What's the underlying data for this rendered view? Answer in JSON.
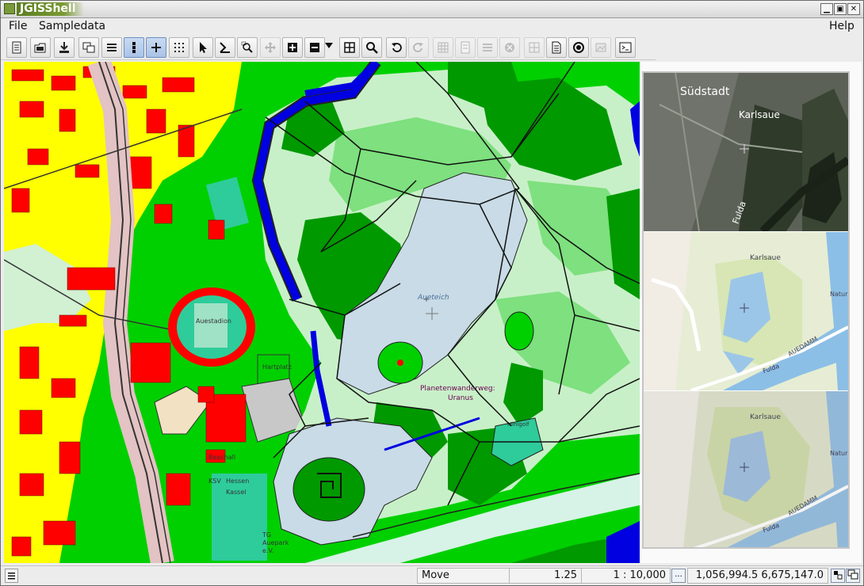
{
  "window": {
    "title": "JGISShell",
    "controls": {
      "minimize": "▁",
      "maximize": "▣",
      "close": "✕"
    }
  },
  "menu": {
    "file": "File",
    "sampledata": "Sampledata",
    "help": "Help"
  },
  "toolbar": {
    "tools": [
      {
        "name": "new-project",
        "icon": "document-icon",
        "state": "normal"
      },
      {
        "name": "open-project",
        "icon": "folder-open-icon",
        "state": "normal"
      },
      {
        "name": "save-project",
        "icon": "download-icon",
        "state": "normal"
      },
      {
        "name": "layers",
        "icon": "windows-icon",
        "state": "normal"
      },
      {
        "name": "list",
        "icon": "list-icon",
        "state": "normal"
      },
      {
        "name": "vertical-dots",
        "icon": "vertical-dots-icon",
        "state": "active"
      },
      {
        "name": "crosshair",
        "icon": "plus-icon",
        "state": "active"
      },
      {
        "name": "grid-dots",
        "icon": "dot-grid-icon",
        "state": "normal"
      },
      {
        "name": "select",
        "icon": "arrow-pointer-icon",
        "state": "normal"
      },
      {
        "name": "select-by-rect",
        "icon": "pen-icon",
        "state": "normal"
      },
      {
        "name": "zoom-rect",
        "icon": "zoom-rect-icon",
        "state": "normal"
      },
      {
        "name": "pan",
        "icon": "move-icon",
        "state": "disabled"
      },
      {
        "name": "zoom-in",
        "icon": "zoom-in-icon",
        "state": "normal"
      },
      {
        "name": "zoom-out",
        "icon": "zoom-out-icon",
        "state": "normal"
      },
      {
        "name": "zoom-extent",
        "icon": "extent-icon",
        "state": "normal"
      },
      {
        "name": "search",
        "icon": "magnifier-icon",
        "state": "normal"
      },
      {
        "name": "undo-view",
        "icon": "undo-icon",
        "state": "normal"
      },
      {
        "name": "redo-view",
        "icon": "redo-icon",
        "state": "disabled"
      },
      {
        "name": "tool-a",
        "icon": "grid-icon",
        "state": "disabled"
      },
      {
        "name": "tool-b",
        "icon": "page-icon",
        "state": "disabled"
      },
      {
        "name": "tool-c",
        "icon": "lines-icon",
        "state": "disabled"
      },
      {
        "name": "tool-d",
        "icon": "cancel-icon",
        "state": "disabled"
      },
      {
        "name": "tool-e",
        "icon": "grid-icon",
        "state": "disabled"
      },
      {
        "name": "properties",
        "icon": "doc-lines-icon",
        "state": "normal"
      },
      {
        "name": "target",
        "icon": "target-icon",
        "state": "normal"
      },
      {
        "name": "image",
        "icon": "image-icon",
        "state": "disabled"
      },
      {
        "name": "console",
        "icon": "terminal-icon",
        "state": "normal"
      }
    ]
  },
  "map": {
    "labels": {
      "aueteich": "Aueteich",
      "auestadion": "Auestadion",
      "hartplatz": "Hartplatz",
      "planetenwanderweg": "Planetenwanderweg:",
      "planetenwanderweg2": "Uranus",
      "ksv": "KSV",
      "ksv2": "Hessen",
      "ksv3": "Kassel",
      "tg": "TG",
      "tg2": "Auepark",
      "tg3": "e.V.",
      "minigolf": "Minigolf",
      "beach": "Beachall"
    },
    "colors": {
      "residential": "#ffff00",
      "building": "#ff0000",
      "park": "#00d000",
      "forest": "#009900",
      "meadow": "#c8f0c8",
      "water": "#c8dbe6",
      "river": "#0000e0",
      "sports": "#2ecc9a"
    }
  },
  "overview": {
    "tile1": {
      "labels": [
        "Südstadt",
        "Karlsaue",
        "Fulda"
      ]
    },
    "tile2": {
      "labels": [
        "Karlsaue",
        "AUEDAMM",
        "Fulda",
        "Natur"
      ]
    },
    "tile3": {
      "labels": [
        "Karlsaue",
        "AUEDAMM",
        "Fulda",
        "Natur"
      ]
    }
  },
  "status": {
    "mode": "Move",
    "zoom": "1.25",
    "scale": "1 : 10,000",
    "scale_button": "...",
    "coordinates": "1,056,994.5 6,675,147.0"
  }
}
